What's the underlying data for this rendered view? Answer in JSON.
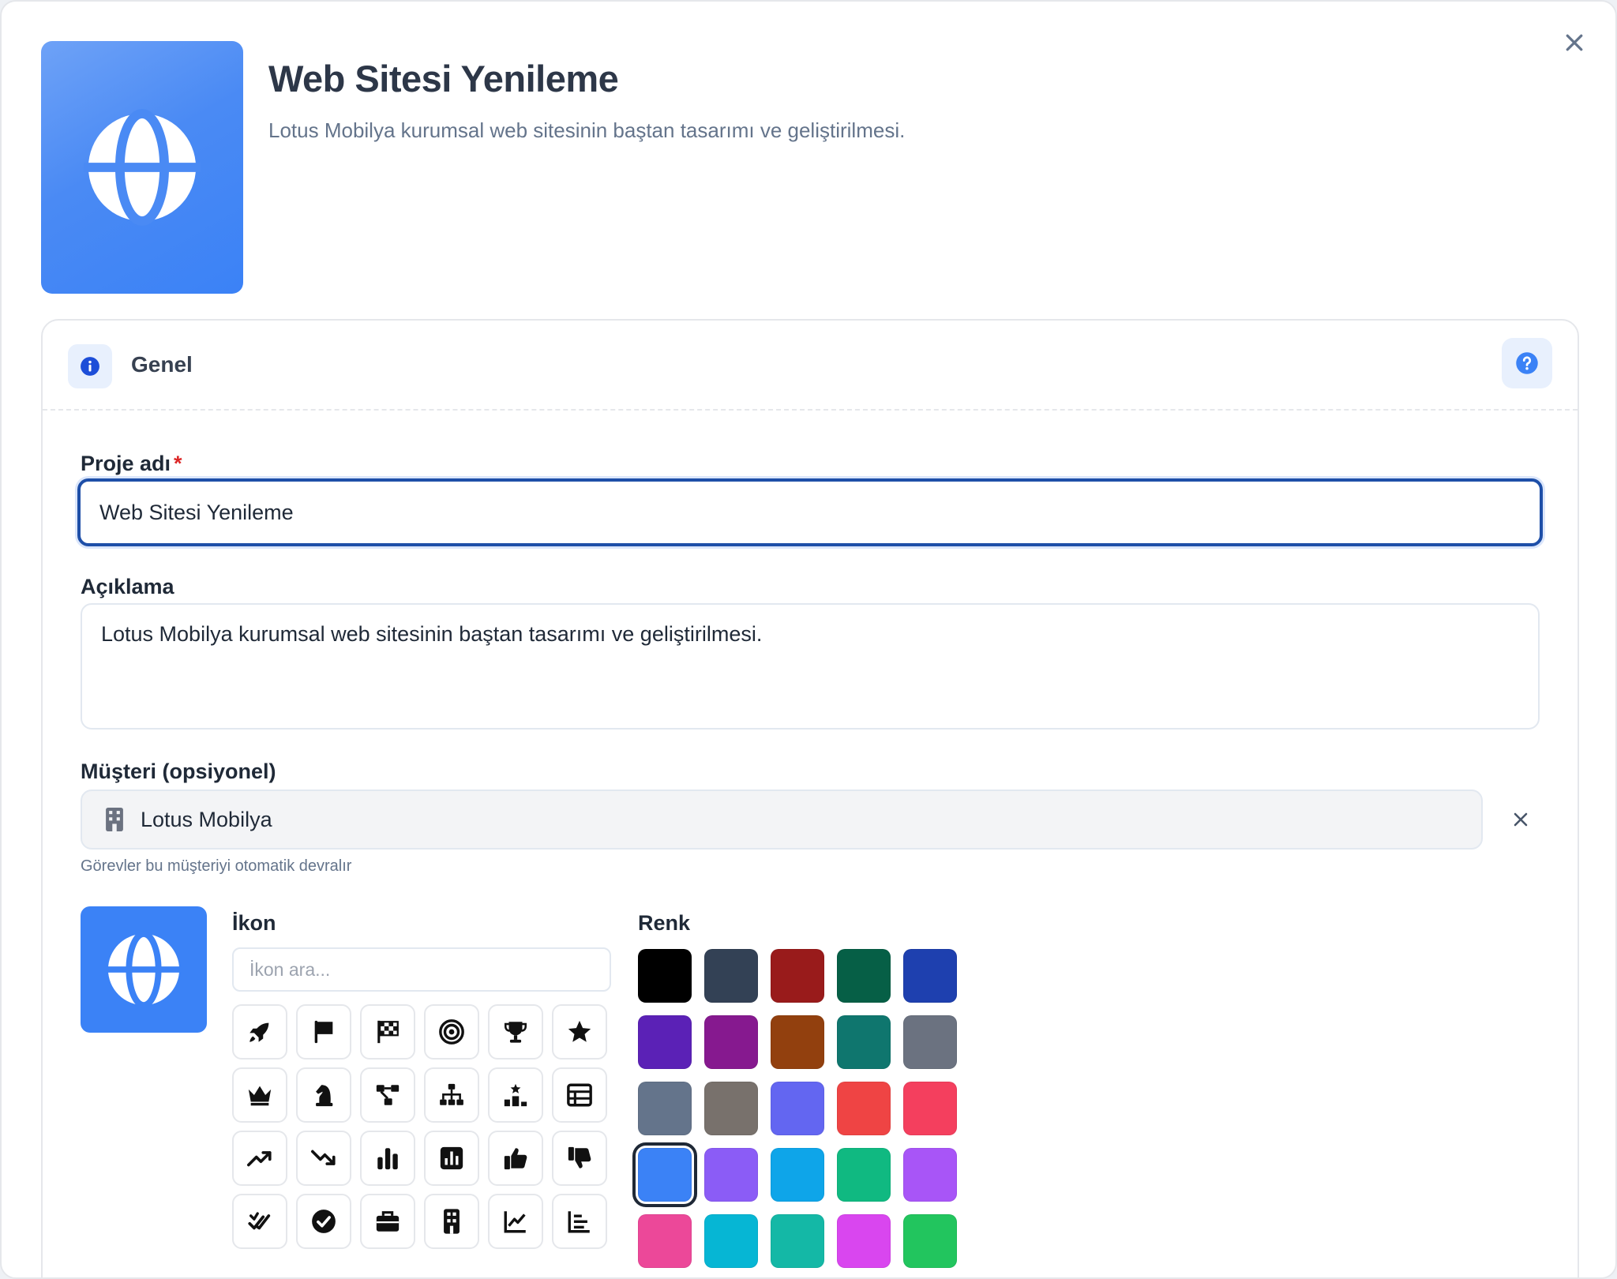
{
  "header": {
    "title": "Web Sitesi Yenileme",
    "description": "Lotus Mobilya kurumsal web sitesinin baştan tasarımı ve geliştirilmesi.",
    "icon": "globe-icon",
    "icon_color": "#3b82f6"
  },
  "section": {
    "title": "Genel",
    "info_icon": "info-icon",
    "help_icon": "question-icon"
  },
  "form": {
    "project_name_label": "Proje adı",
    "required_mark": "*",
    "project_name_value": "Web Sitesi Yenileme",
    "description_label": "Açıklama",
    "description_value": "Lotus Mobilya kurumsal web sitesinin baştan tasarımı ve geliştirilmesi.",
    "client_label": "Müşteri (opsiyonel)",
    "client_value": "Lotus Mobilya",
    "client_hint": "Görevler bu müşteriyi otomatik devralır"
  },
  "icon_picker": {
    "label": "İkon",
    "search_placeholder": "İkon ara...",
    "icons": [
      "rocket-icon",
      "flag-icon",
      "checkered-flag-icon",
      "target-icon",
      "trophy-icon",
      "star-icon",
      "crown-icon",
      "chess-knight-icon",
      "diagram-icon",
      "sitemap-icon",
      "ranking-icon",
      "table-icon",
      "trend-up-icon",
      "trend-down-icon",
      "bar-chart-icon",
      "chart-square-icon",
      "thumbs-up-icon",
      "thumbs-down-icon",
      "double-check-icon",
      "check-circle-icon",
      "briefcase-icon",
      "building-icon",
      "line-chart-icon",
      "list-chart-icon"
    ]
  },
  "color_picker": {
    "label": "Renk",
    "selected": "#3b82f6",
    "colors": [
      "#000000",
      "#334155",
      "#991b1b",
      "#065f46",
      "#1e40af",
      "#5b21b6",
      "#86198f",
      "#92400e",
      "#0f766e",
      "#6b7280",
      "#64748b",
      "#78716c",
      "#6366f1",
      "#ef4444",
      "#f43f5e",
      "#3b82f6",
      "#8b5cf6",
      "#0ea5e9",
      "#10b981",
      "#a855f7",
      "#ec4899",
      "#06b6d4",
      "#14b8a6",
      "#d946ef",
      "#22c55e"
    ]
  }
}
